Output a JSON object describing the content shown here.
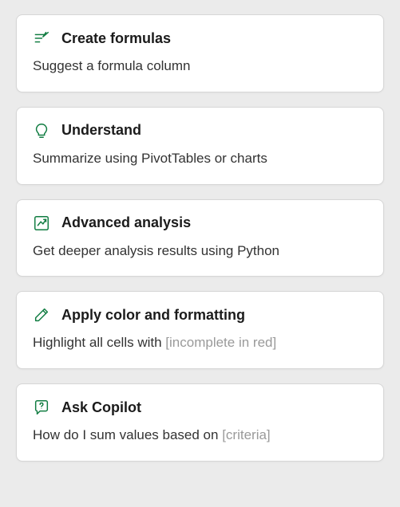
{
  "cards": [
    {
      "title": "Create formulas",
      "desc": "Suggest a formula column",
      "placeholder": ""
    },
    {
      "title": "Understand",
      "desc": "Summarize using PivotTables or charts",
      "placeholder": ""
    },
    {
      "title": "Advanced analysis",
      "desc": "Get deeper analysis results using Python",
      "placeholder": ""
    },
    {
      "title": "Apply color and formatting",
      "desc": "Highlight all cells with ",
      "placeholder": "[incomplete in red]"
    },
    {
      "title": "Ask Copilot",
      "desc": "How do I sum values based on ",
      "placeholder": "[criteria]"
    }
  ]
}
